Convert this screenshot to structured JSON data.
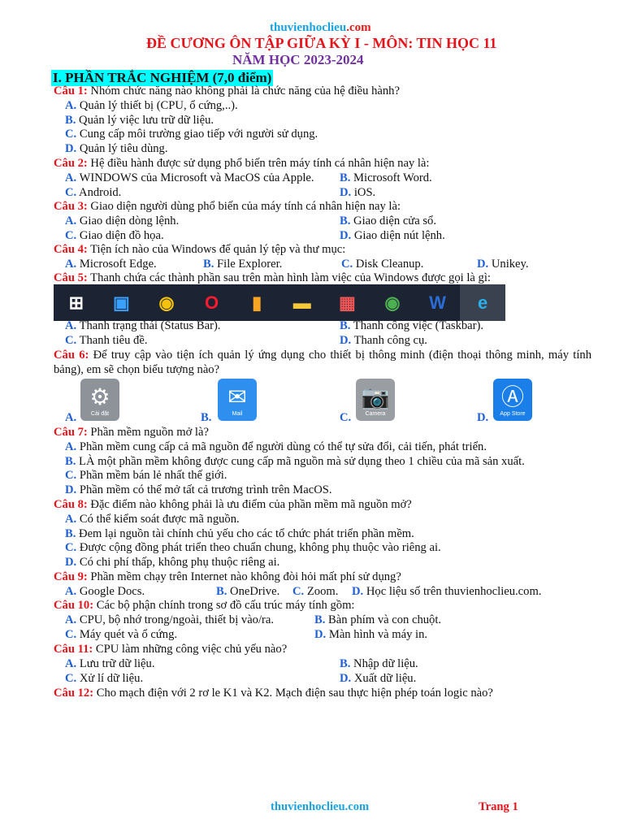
{
  "header": {
    "site_main": "thuvienhoclieu",
    "site_tld": ".com",
    "title": "ĐỀ CƯƠNG ÔN TẬP GIỮA KỲ I - MÔN: TIN HỌC 11",
    "year": "NĂM HỌC 2023-2024",
    "section": "I. PHẦN TRẮC NGHIỆM (7,0 điểm)"
  },
  "questions": [
    {
      "label": "Câu 1:",
      "text": " Nhóm chức năng nào không phải là chức năng của hệ điều hành?",
      "options": [
        {
          "l": "A.",
          "t": " Quản lý thiết bị (CPU, ổ cứng,..)."
        },
        {
          "l": "B.",
          "t": " Quản lý việc lưu trữ dữ liệu."
        },
        {
          "l": "C.",
          "t": " Cung cấp môi trường giao tiếp với người sử dụng."
        },
        {
          "l": "D.",
          "t": " Quản lý tiêu dùng."
        }
      ]
    },
    {
      "label": "Câu 2:",
      "text": " Hệ điều hành được sử dụng phổ biến trên máy tính cá nhân hiện nay là:",
      "options": [
        {
          "l": "A.",
          "t": " WINDOWS của Microsoft và MacOS của Apple."
        },
        {
          "l": "B.",
          "t": " Microsoft Word."
        },
        {
          "l": "C.",
          "t": " Android."
        },
        {
          "l": "D.",
          "t": " iOS."
        }
      ]
    },
    {
      "label": "Câu 3:",
      "text": " Giao diện người dùng phổ biến của máy tính cá nhân hiện nay là:",
      "options": [
        {
          "l": "A.",
          "t": " Giao diện dòng lệnh."
        },
        {
          "l": "B.",
          "t": " Giao diện cửa sổ."
        },
        {
          "l": "C.",
          "t": " Giao diện đồ họa."
        },
        {
          "l": "D.",
          "t": " Giao diện nút lệnh."
        }
      ]
    },
    {
      "label": "Câu 4:",
      "text": " Tiện ích nào của Windows để quản lý tệp và thư mục:",
      "options": [
        {
          "l": "A.",
          "t": " Microsoft Edge."
        },
        {
          "l": "B.",
          "t": " File Explorer."
        },
        {
          "l": "C.",
          "t": " Disk Cleanup."
        },
        {
          "l": "D.",
          "t": " Unikey."
        }
      ]
    },
    {
      "label": "Câu 5:",
      "text": " Thanh chứa các thành phần sau trên màn hình làm việc của Windows được gọi là gì:",
      "options": [
        {
          "l": "A.",
          "t": " Thanh trạng thái (Status Bar)."
        },
        {
          "l": "B.",
          "t": " Thanh công việc (Taskbar)."
        },
        {
          "l": "C.",
          "t": " Thanh tiêu đề."
        },
        {
          "l": "D.",
          "t": " Thanh công cụ."
        }
      ]
    },
    {
      "label": "Câu 6:",
      "text": " Để truy cập vào tiện ích quản lý ứng dụng cho thiết bị thông minh (điện thoại thông minh, máy tính bảng), em sẽ chọn biểu tượng nào?",
      "options": [
        {
          "l": "A.",
          "t": "Cài đặt"
        },
        {
          "l": "B.",
          "t": "Mail"
        },
        {
          "l": "C.",
          "t": "Camera"
        },
        {
          "l": "D.",
          "t": "App Store"
        }
      ]
    },
    {
      "label": "Câu 7:",
      "text": " Phần mềm nguồn mở là?",
      "options": [
        {
          "l": "A.",
          "t": " Phần mềm cung cấp cả mã nguồn để người dùng có thể tự sửa đổi, cải tiến, phát triển."
        },
        {
          "l": "B.",
          "t": " LÀ một phần mềm không được cung cấp mã nguồn mà sử dụng theo 1 chiều của mã sản xuất."
        },
        {
          "l": "C.",
          "t": " Phần mềm bán lẻ nhất thế giới."
        },
        {
          "l": "D.",
          "t": " Phần mềm có thể mở tất cả trương trình trên MacOS."
        }
      ]
    },
    {
      "label": "Câu 8:",
      "text": " Đặc điểm nào không phải là ưu điểm của phần mềm mã nguồn mở?",
      "options": [
        {
          "l": "A.",
          "t": " Có thể kiểm soát được mã nguồn."
        },
        {
          "l": "B.",
          "t": " Đem lại nguồn tài chính chủ yếu cho các tổ chức phát triển phần mềm."
        },
        {
          "l": "C.",
          "t": " Được cộng đồng phát triển theo chuẩn chung, không phụ thuộc vào riêng ai."
        },
        {
          "l": "D.",
          "t": " Có chi phí thấp, không phụ thuộc riêng ai."
        }
      ]
    },
    {
      "label": "Câu 9:",
      "text": " Phần mềm chạy trên Internet nào không đòi hỏi mất phí sử dụng?",
      "options": [
        {
          "l": "A.",
          "t": " Google Docs."
        },
        {
          "l": "B.",
          "t": " OneDrive."
        },
        {
          "l": "C.",
          "t": " Zoom."
        },
        {
          "l": "D.",
          "t": " Học liệu số trên thuvienhoclieu.com."
        }
      ]
    },
    {
      "label": "Câu 10:",
      "text": " Các bộ phận chính trong sơ đồ cấu trúc máy tính gồm:",
      "options": [
        {
          "l": "A.",
          "t": " CPU, bộ nhớ trong/ngoài, thiết bị vào/ra."
        },
        {
          "l": "B.",
          "t": " Bàn phím và con chuột."
        },
        {
          "l": "C.",
          "t": " Máy quét và ổ cứng."
        },
        {
          "l": "D.",
          "t": " Màn hình và máy in."
        }
      ]
    },
    {
      "label": "Câu 11:",
      "text": " CPU làm những công việc chủ yếu nào?",
      "options": [
        {
          "l": "A.",
          "t": " Lưu trữ dữ liệu."
        },
        {
          "l": "B.",
          "t": " Nhập dữ liệu."
        },
        {
          "l": "C.",
          "t": " Xử lí dữ liệu."
        },
        {
          "l": "D.",
          "t": " Xuất dữ liệu."
        }
      ]
    },
    {
      "label": "Câu 12:",
      "text": " Cho mạch điện với 2 rơ le K1 và K2. Mạch điện sau thực hiện phép toán logic nào?",
      "options": []
    }
  ],
  "taskbar": [
    "windows-start",
    "microsoft-store",
    "chrome",
    "opera",
    "app",
    "file-explorer",
    "unikey",
    "chrome-profile",
    "word",
    "edge"
  ],
  "footer": {
    "site": "thuvienhoclieu.com",
    "page": "Trang 1"
  },
  "colors": {
    "question_label": "#e8141b",
    "option_label": "#1f5fd6",
    "section_bg": "#00ffff",
    "year": "#7030a0"
  }
}
